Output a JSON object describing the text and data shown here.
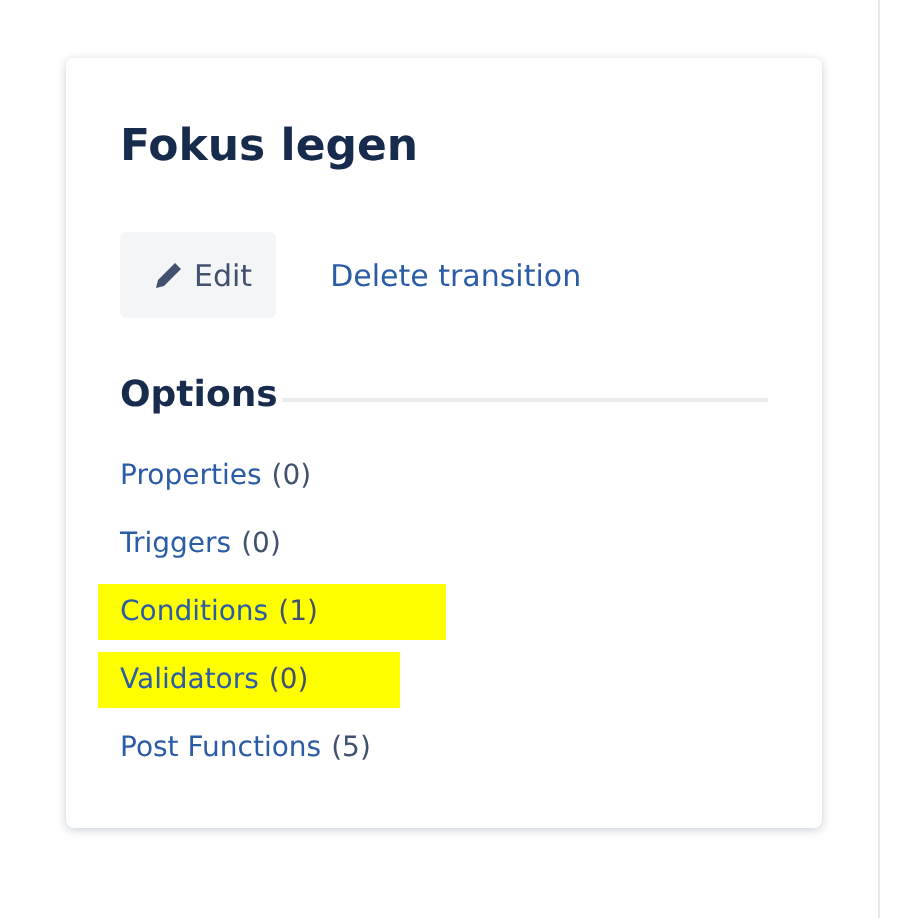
{
  "title": "Fokus legen",
  "actions": {
    "edit": {
      "label": "Edit"
    },
    "delete": {
      "label": "Delete transition"
    }
  },
  "options": {
    "heading": "Options",
    "items": [
      {
        "label": "Properties",
        "count": "(0)",
        "highlighted": false
      },
      {
        "label": "Triggers",
        "count": "(0)",
        "highlighted": false
      },
      {
        "label": "Conditions",
        "count": "(1)",
        "highlighted": true
      },
      {
        "label": "Validators",
        "count": "(0)",
        "highlighted": true
      },
      {
        "label": "Post Functions",
        "count": "(5)",
        "highlighted": false
      }
    ]
  }
}
